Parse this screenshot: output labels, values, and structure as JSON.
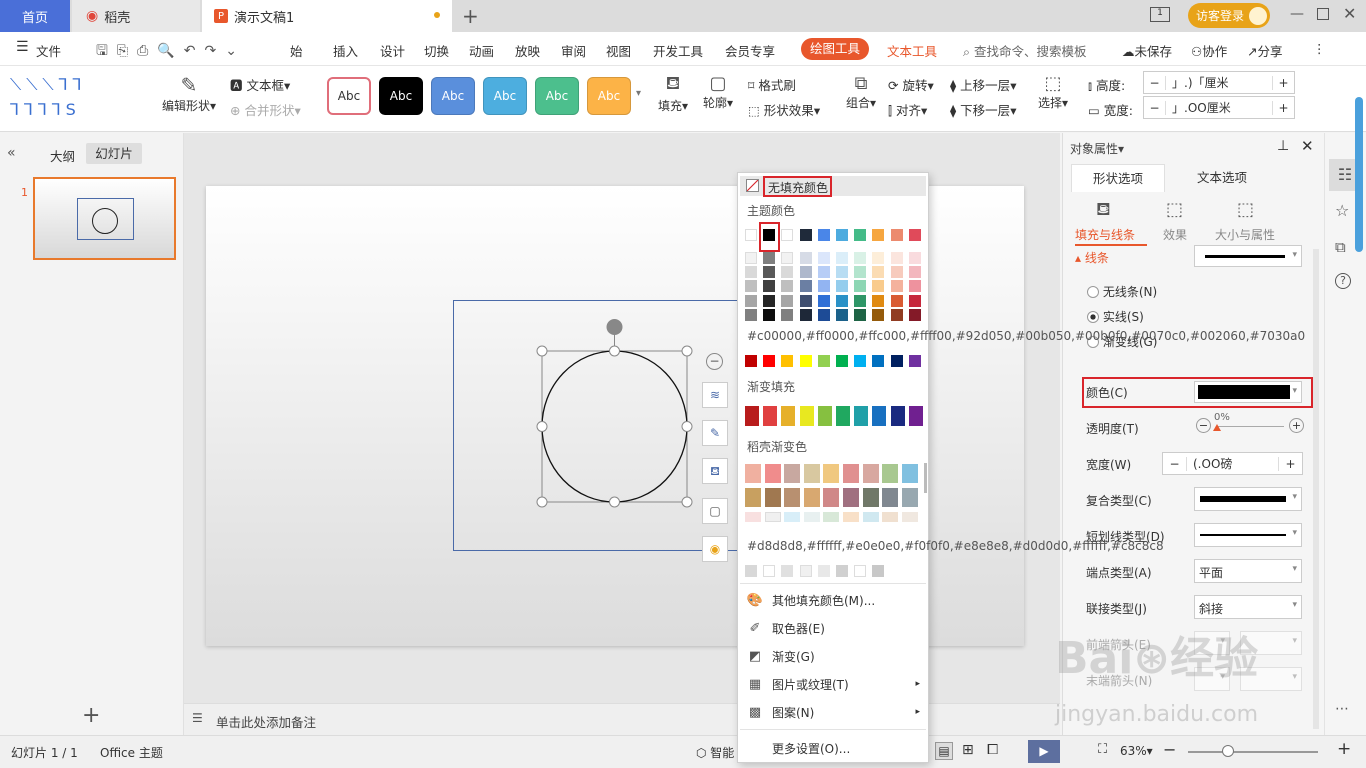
{
  "tabs": {
    "home": "首页",
    "daoke": "稻壳",
    "doc": "演示文稿1",
    "login": "访客登录"
  },
  "menu": {
    "file": "文件",
    "items": [
      "始",
      "插入",
      "设计",
      "切换",
      "动画",
      "放映",
      "审阅",
      "视图",
      "开发工具",
      "会员专享"
    ],
    "drawing_tools": "绘图工具",
    "text_tools": "文本工具",
    "search": "查找命令、搜索模板",
    "unsaved": "未保存",
    "collab": "协作",
    "share": "分享"
  },
  "ribbon": {
    "edit_shape": "编辑形状",
    "textbox": "文本框",
    "merge_shape": "合并形状",
    "style_label": "Abc",
    "fill": "填充",
    "outline": "轮廓",
    "format_brush": "格式刷",
    "shape_effect": "形状效果",
    "group": "组合",
    "rotate": "旋转",
    "align": "对齐",
    "bring_up": "上移一层",
    "send_down": "下移一层",
    "select": "选择",
    "height_label": "高度:",
    "width_label": "宽度:",
    "height_value": "」.)「厘米",
    "width_value": "」.OO厘米",
    "style_colors": [
      "#ffffff",
      "#000000",
      "#5a8fdc",
      "#4daedf",
      "#4cbf8d",
      "#fcb347"
    ]
  },
  "left": {
    "outline": "大纲",
    "slides": "幻灯片",
    "slide_num": "1"
  },
  "notes": {
    "hint": "单击此处添加备注"
  },
  "status": {
    "slide": "幻灯片 1 / 1",
    "theme": "Office 主题",
    "smart": "智能",
    "zoom": "63%"
  },
  "panel": {
    "title": "对象属性",
    "tab_shape": "形状选项",
    "tab_text": "文本选项",
    "sub_fill": "填充与线条",
    "sub_effect": "效果",
    "sub_size": "大小与属性",
    "section_line": "线条",
    "no_line": "无线条(N)",
    "solid": "实线(S)",
    "gradient": "渐变线(G)",
    "color": "颜色(C)",
    "transparency": "透明度(T)",
    "trans_value": "0%",
    "width": "宽度(W)",
    "width_value": "(.OO磅",
    "compound": "复合类型(C)",
    "dash": "短划线类型(D)",
    "cap": "端点类型(A)",
    "cap_value": "平面",
    "join": "联接类型(J)",
    "join_value": "斜接",
    "arrow_front": "前端箭头(E)",
    "arrow_end": "末端箭头(N)"
  },
  "popup": {
    "no_fill": "无填充颜色",
    "theme": "主题颜色",
    "standard": [
      "#c00000",
      "#ff0000",
      "#ffc000",
      "#ffff00",
      "#92d050",
      "#00b050",
      "#00b0f0",
      "#0070c0",
      "#002060",
      "#7030a0"
    ],
    "gradient_fill": "渐变填充",
    "daoke_gradient": "稻壳渐变色",
    "recent": [
      "#d8d8d8",
      "#ffffff",
      "#e0e0e0",
      "#f0f0f0",
      "#e8e8e8",
      "#d0d0d0",
      "#ffffff",
      "#c8c8c8"
    ],
    "other": "其他填充颜色(M)...",
    "picker": "取色器(E)",
    "gradient": "渐变(G)",
    "picture": "图片或纹理(T)",
    "pattern": "图案(N)",
    "more": "更多设置(O)...",
    "theme_top": [
      "#ffffff",
      "#000000",
      "#ffffff",
      "#1f2a3a",
      "#4a86e8",
      "#4dabdf",
      "#44bb88",
      "#f6a640",
      "#ec8a6e",
      "#e04a5a"
    ],
    "theme_cols": [
      [
        "#f2f2f2",
        "#d9d9d9",
        "#bfbfbf",
        "#a6a6a6",
        "#808080"
      ],
      [
        "#7f7f7f",
        "#595959",
        "#404040",
        "#262626",
        "#0d0d0d"
      ],
      [
        "#f2f2f2",
        "#d9d9d9",
        "#bfbfbf",
        "#a6a6a6",
        "#808080"
      ],
      [
        "#d6dbe6",
        "#aeb8cc",
        "#6b7fa3",
        "#3f4f70",
        "#1e2838"
      ],
      [
        "#dbe6fb",
        "#b7cdf6",
        "#92b4f2",
        "#2f6fd6",
        "#1d4b96"
      ],
      [
        "#dbeef9",
        "#b8ddf3",
        "#94cded",
        "#2a91c7",
        "#1b618a"
      ],
      [
        "#d9f1e6",
        "#b3e4cd",
        "#8cd6b3",
        "#2e9667",
        "#1e6445"
      ],
      [
        "#fdeed9",
        "#fbdcb3",
        "#f9cb8c",
        "#e08a12",
        "#955b0b"
      ],
      [
        "#fbe5de",
        "#f7cbbd",
        "#f4b29d",
        "#d95b33",
        "#913c22"
      ],
      [
        "#f9dbde",
        "#f3b7be",
        "#ee929e",
        "#c6273c",
        "#841a28"
      ]
    ],
    "gradient_row": [
      "#b81c1c",
      "#e04040",
      "#e6b02a",
      "#e8e820",
      "#86c040",
      "#20a860",
      "#20a0a8",
      "#1870c0",
      "#1a2a80",
      "#702090"
    ],
    "daoke_rows": [
      [
        "#f0b0a0",
        "#f08c8c",
        "#c8a8a0",
        "#d8c8a0",
        "#f0c880",
        "#e09090",
        "#d8a8a0",
        "#a8c890",
        "#80c0e0"
      ],
      [
        "#c8a060",
        "#a07850",
        "#b89070",
        "#d8a870",
        "#d08888",
        "#a07080",
        "#707868",
        "#808890",
        "#98a8b0"
      ],
      [
        "#f8e0e0",
        "#f0f0f0",
        "#d8eef8",
        "#e8f0f0",
        "#d8e8d8",
        "#f8e0c8",
        "#d0e8f0",
        "#f0e0d0",
        "#f0e8e0"
      ]
    ]
  }
}
